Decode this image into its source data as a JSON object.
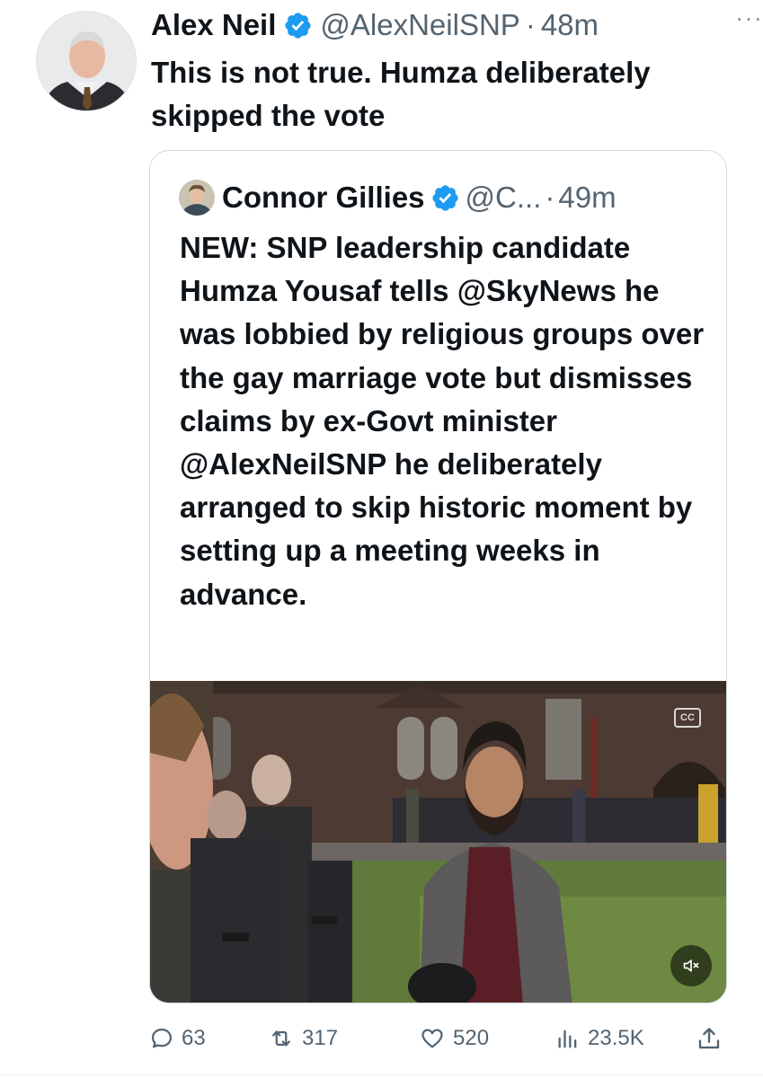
{
  "author": {
    "name": "Alex Neil",
    "handle": "@AlexNeilSNP",
    "separator": "·",
    "time": "48m",
    "verified": true,
    "more_icon": "more-horizontal-icon"
  },
  "tweet": {
    "text": "This is not true. Humza deliberately skipped the vote"
  },
  "quote": {
    "name": "Connor Gillies",
    "handle": "@C...",
    "separator": "·",
    "time": "49m",
    "verified": true,
    "text": "NEW: SNP leadership candidate Humza Yousaf tells @SkyNews he was lobbied by religious groups over the gay marriage vote but dismisses claims by ex-Govt minister @AlexNeilSNP he deliberately arranged to skip historic moment by setting up a meeting weeks in advance.",
    "media": {
      "type": "video",
      "cc_label": "CC",
      "mute_icon": "volume-muted-icon"
    }
  },
  "actions": {
    "replies": "63",
    "retweets": "317",
    "likes": "520",
    "views": "23.5K",
    "icons": [
      "reply-icon",
      "retweet-icon",
      "like-icon",
      "views-icon",
      "share-icon"
    ]
  },
  "colors": {
    "verified": "#1d9bf0",
    "secondary_text": "#536471",
    "border": "#cfd9de"
  }
}
